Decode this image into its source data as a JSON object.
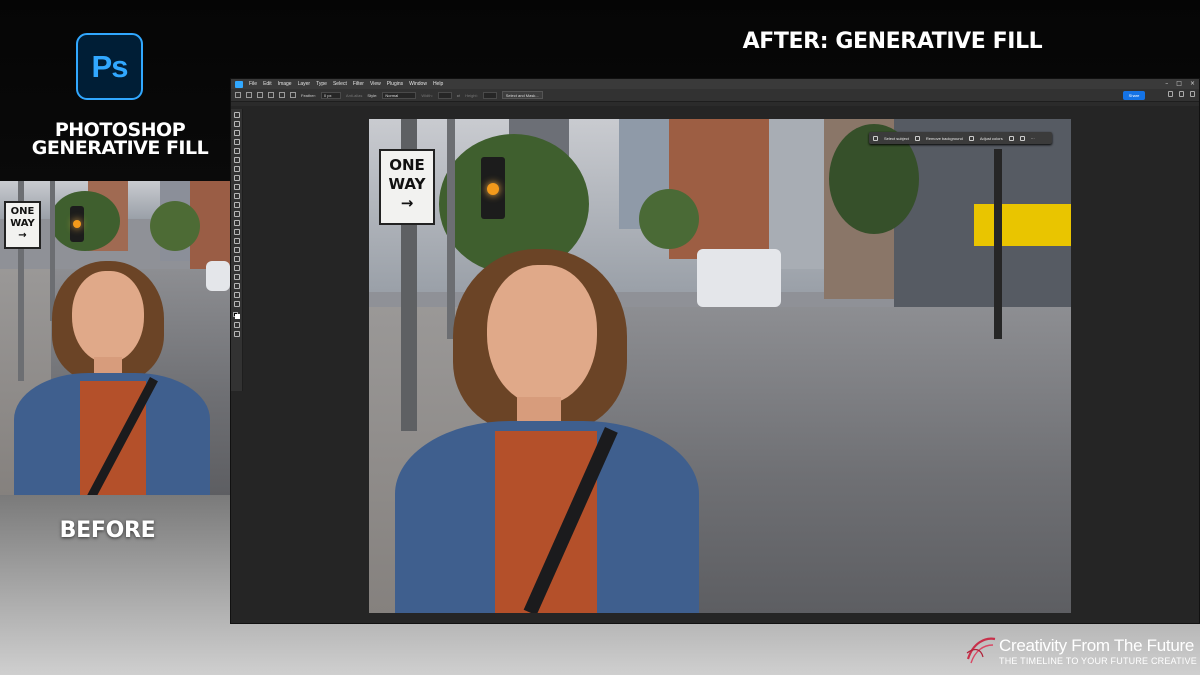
{
  "promo": {
    "app_logo_text": "Ps",
    "title_line1": "PHOTOSHOP",
    "title_line2": "GENERATIVE FILL",
    "after_label": "AFTER: GENERATIVE FILL",
    "before_label": "BEFORE"
  },
  "photo": {
    "sign_line1": "ONE",
    "sign_line2": "WAY",
    "sign_arrow": "→"
  },
  "photoshop": {
    "menu": [
      "File",
      "Edit",
      "Image",
      "Layer",
      "Type",
      "Select",
      "Filter",
      "View",
      "Plugins",
      "Window",
      "Help"
    ],
    "options": {
      "feather_label": "Feather:",
      "feather_value": "0 px",
      "anti_alias_label": "Anti-alias",
      "style_label": "Style:",
      "style_value": "Normal",
      "width_label": "Width:",
      "height_label": "Height:",
      "select_mask_button": "Select and Mask...",
      "share_button": "Share"
    },
    "context_bar": {
      "select_subject": "Select subject",
      "remove_background": "Remove background",
      "adjust_colors": "Adjust colors"
    }
  },
  "brand": {
    "name": "Creativity From The Future",
    "tagline": "THE TIMELINE TO YOUR FUTURE CREATIVE"
  }
}
